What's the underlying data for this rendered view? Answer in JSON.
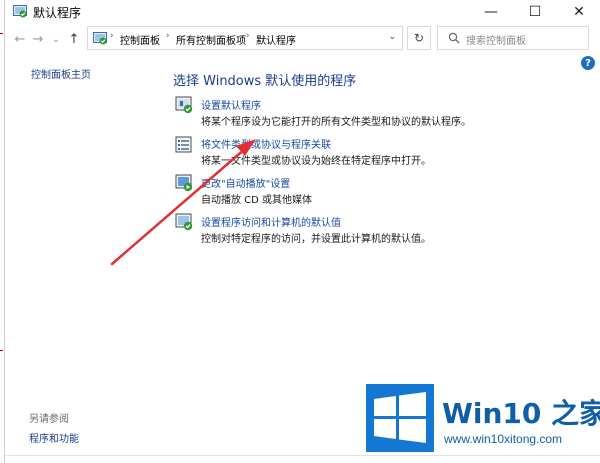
{
  "window": {
    "title": "默认程序",
    "minimize_glyph": "—",
    "maximize_glyph": "☐",
    "close_glyph": "✕"
  },
  "nav": {
    "back_glyph": "←",
    "forward_glyph": "→",
    "down_glyph": "⌄",
    "up_glyph": "↑",
    "refresh_glyph": "↻",
    "addr_drop_glyph": "⌄"
  },
  "breadcrumb": {
    "items": [
      "控制面板",
      "所有控制面板项",
      "默认程序"
    ],
    "sep": "›"
  },
  "search": {
    "placeholder": "搜索控制面板"
  },
  "help_glyph": "?",
  "sidebar": {
    "home_link": "控制面板主页",
    "see_also": "另请参阅",
    "programs_link": "程序和功能"
  },
  "main": {
    "heading": "选择 Windows 默认使用的程序",
    "items": [
      {
        "link": "设置默认程序",
        "desc": "将某个程序设为它能打开的所有文件类型和协议的默认程序。",
        "icon": "default-programs-icon"
      },
      {
        "link": "将文件类型或协议与程序关联",
        "desc": "将某一文件类型或协议设为始终在特定程序中打开。",
        "icon": "file-association-icon"
      },
      {
        "link": "更改\"自动播放\"设置",
        "desc": "自动播放 CD 或其他媒体",
        "icon": "autoplay-icon"
      },
      {
        "link": "设置程序访问和计算机的默认值",
        "desc": "控制对特定程序的访问，并设置此计算机的默认值。",
        "icon": "program-access-icon"
      }
    ]
  },
  "watermark": {
    "brand": "Win10",
    "brand_suffix": "之家",
    "url": "www.win10xitong.com"
  },
  "colors": {
    "link": "#1a48a8",
    "heading": "#1b3b8f",
    "annotation": "#e03232",
    "logo": "#0f5ea8"
  }
}
